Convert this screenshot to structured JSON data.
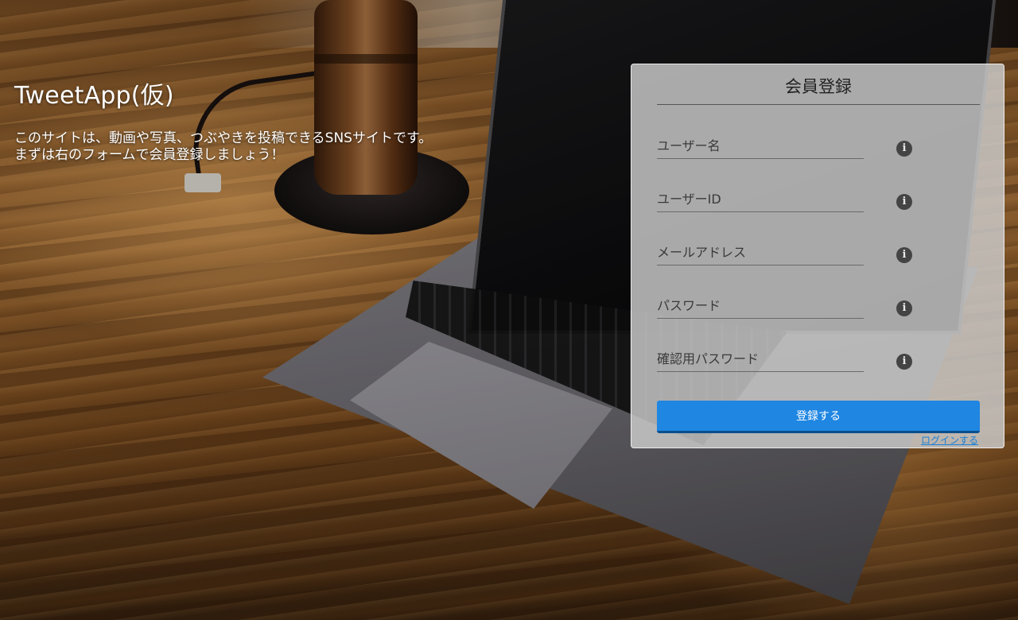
{
  "hero": {
    "title": "TweetApp(仮)",
    "description_line1": "このサイトは、動画や写真、つぶやきを投稿できるSNSサイトです。",
    "description_line2": "まずは右のフォームで会員登録しましょう！"
  },
  "form": {
    "title": "会員登録",
    "fields": [
      {
        "placeholder": "ユーザー名",
        "value": "",
        "icon": "info-icon"
      },
      {
        "placeholder": "ユーザーID",
        "value": "",
        "icon": "info-icon"
      },
      {
        "placeholder": "メールアドレス",
        "value": "",
        "icon": "info-icon"
      },
      {
        "placeholder": "パスワード",
        "value": "",
        "icon": "info-icon"
      },
      {
        "placeholder": "確認用パスワード",
        "value": "",
        "icon": "info-icon"
      }
    ],
    "info_glyph": "i",
    "submit_label": "登録する",
    "login_link": "ログインする"
  },
  "colors": {
    "accent": "#1f86e2",
    "link": "#1a7fd6",
    "card_bg": "#cdcdcd"
  }
}
